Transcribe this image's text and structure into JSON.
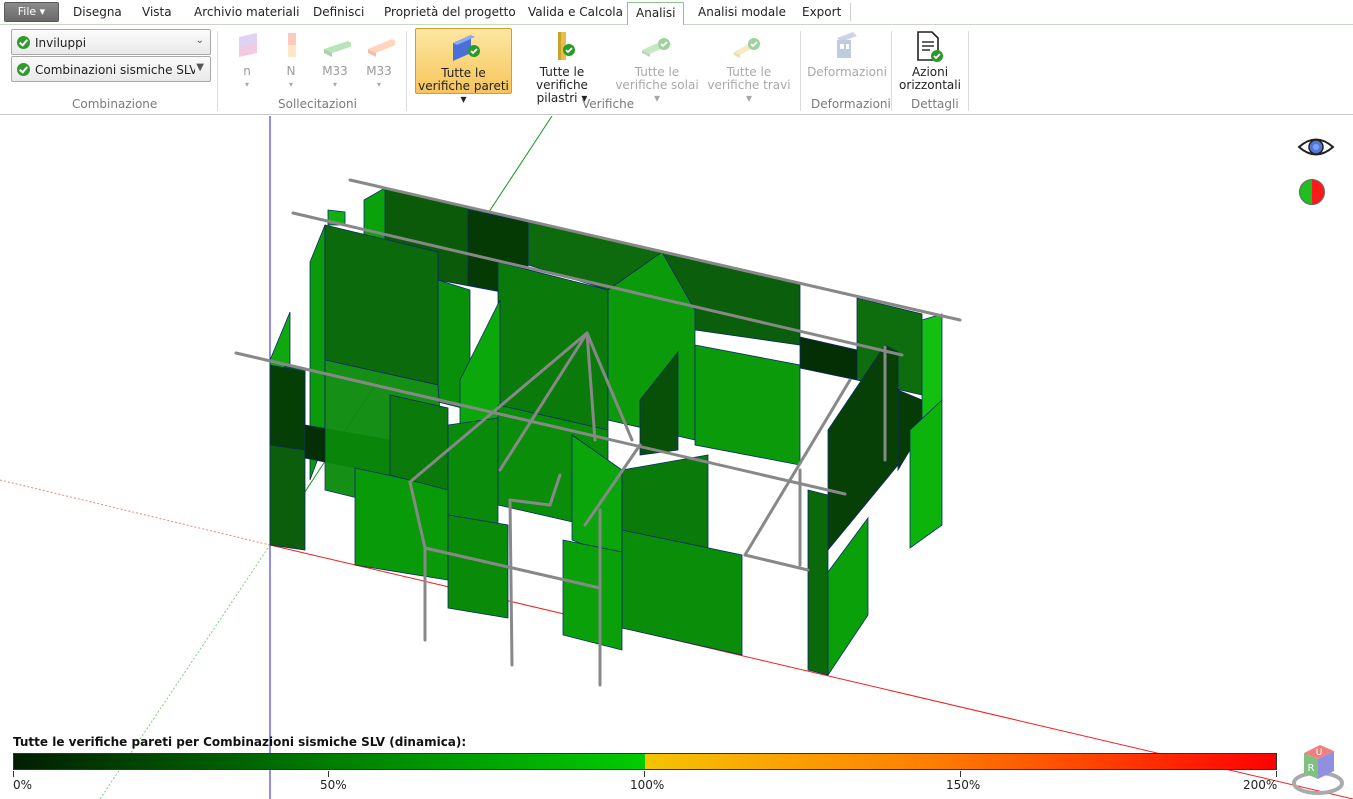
{
  "menu": {
    "file_label": "File ▾",
    "tabs": [
      "Disegna",
      "Vista",
      "Archivio materiali",
      "Definisci",
      "Proprietà del progetto",
      "Valida e Calcola",
      "Analisi",
      "Analisi modale",
      "Export"
    ],
    "active_tab": "Analisi"
  },
  "ribbon": {
    "combinazione": {
      "combo1": "Inviluppi",
      "combo2": "Combinazioni sismiche SLV (d",
      "group_label": "Combinazione"
    },
    "sollecitazioni": {
      "buttons": [
        {
          "label": "n",
          "dd": "▾"
        },
        {
          "label": "N",
          "dd": "▾"
        },
        {
          "label": "M33",
          "dd": "▾"
        },
        {
          "label": "M33",
          "dd": "▾"
        }
      ],
      "group_label": "Sollecitazioni"
    },
    "verifiche": {
      "pareti": {
        "line1": "Tutte le",
        "line2": "verifiche pareti ▾"
      },
      "pilastri": {
        "line1": "Tutte le",
        "line2": "verifiche pilastri ▾"
      },
      "solai": {
        "line1": "Tutte le",
        "line2": "verifiche solai ▾"
      },
      "travi": {
        "line1": "Tutte le",
        "line2": "verifiche travi ▾"
      },
      "group_label": "Verifiche"
    },
    "deformazioni": {
      "button": "Deformazioni",
      "group_label": "Deformazioni"
    },
    "dettagli": {
      "line1": "Azioni",
      "line2": "orizzontali",
      "group_label": "Dettagli"
    }
  },
  "legend": {
    "title": "Tutte le verifiche pareti per Combinazioni sismiche SLV (dinamica):",
    "ticks": [
      "0%",
      "50%",
      "100%",
      "150%",
      "200%"
    ]
  },
  "navcube": {
    "label_top": "U",
    "label_front": "R"
  },
  "colors": {
    "accent_green": "#8fc08a",
    "selected_button": "#f7c45a",
    "legend_low": "#001f00",
    "legend_mid": "#00cc00",
    "legend_high": "#ff0000"
  }
}
